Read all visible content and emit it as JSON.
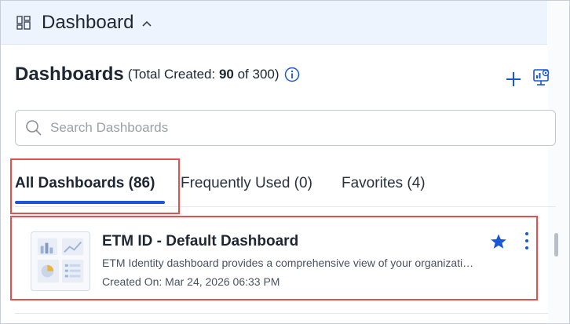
{
  "header": {
    "title": "Dashboard",
    "menu_icon": "layout-grid-icon",
    "chevron_icon": "chevron-up-icon"
  },
  "main": {
    "heading": "Dashboards",
    "meta_prefix": "(Total Created: ",
    "created_count": "90",
    "meta_suffix": " of 300)",
    "info_icon": "info-icon",
    "add_icon": "plus-icon",
    "settings_icon": "dashboard-settings-icon"
  },
  "search": {
    "placeholder": "Search Dashboards",
    "value": "",
    "icon": "search-icon"
  },
  "tabs": [
    {
      "label": "All Dashboards (86)",
      "active": true
    },
    {
      "label": "Frequently Used (0)",
      "active": false
    },
    {
      "label": "Favorites (4)",
      "active": false
    }
  ],
  "cards": [
    {
      "name": "ETM ID - Default Dashboard",
      "description": "ETM Identity dashboard provides a comprehensive view of your organization...",
      "created": "Created On: Mar 24, 2026 06:33 PM",
      "favorite": true,
      "thumbnail_icon": "dashboard-thumbnail-icon"
    }
  ],
  "colors": {
    "accent": "#1a56d6",
    "highlight_border": "#e05252",
    "header_bg": "#eef4fd"
  }
}
